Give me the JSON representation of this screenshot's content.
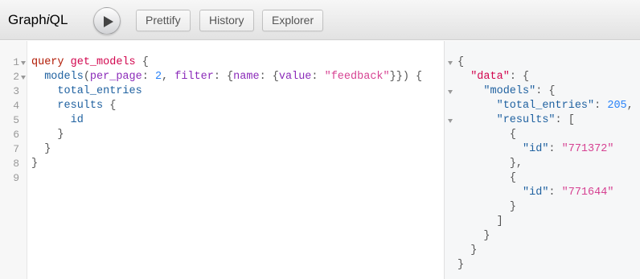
{
  "app": {
    "title_prefix": "Graph",
    "title_italic": "i",
    "title_suffix": "QL"
  },
  "toolbar": {
    "execute_icon": "play-icon",
    "prettify_label": "Prettify",
    "history_label": "History",
    "explorer_label": "Explorer"
  },
  "query_editor": {
    "line_numbers": [
      "1",
      "2",
      "3",
      "4",
      "5",
      "6",
      "7",
      "8",
      "9"
    ],
    "lines": [
      {
        "t1": "query",
        "t2": " ",
        "t3": "get_models",
        "t4": " {"
      },
      {
        "t1": "  ",
        "t2": "models",
        "t3": "(",
        "t4": "per_page",
        "t5": ": ",
        "t6": "2",
        "t7": ", ",
        "t8": "filter",
        "t9": ": {",
        "t10": "name",
        "t11": ": {",
        "t12": "value",
        "t13": ": ",
        "t14": "\"feedback\"",
        "t15": "}}) {"
      },
      {
        "t1": "    ",
        "t2": "total_entries"
      },
      {
        "t1": "    ",
        "t2": "results",
        "t3": " {"
      },
      {
        "t1": "      ",
        "t2": "id"
      },
      {
        "t1": "    ",
        "t2": "}"
      },
      {
        "t1": "  ",
        "t2": "}"
      },
      {
        "t1": "",
        "t2": "}"
      },
      {
        "t1": "",
        "t2": ""
      }
    ]
  },
  "result_viewer": {
    "lines": [
      {
        "t1": "{"
      },
      {
        "t1": "  ",
        "t2": "\"data\"",
        "t3": ": {"
      },
      {
        "t1": "    ",
        "t2": "\"models\"",
        "t3": ": {"
      },
      {
        "t1": "      ",
        "t2": "\"total_entries\"",
        "t3": ": ",
        "t4": "205",
        "t5": ","
      },
      {
        "t1": "      ",
        "t2": "\"results\"",
        "t3": ": ["
      },
      {
        "t1": "        ",
        "t2": "{"
      },
      {
        "t1": "          ",
        "t2": "\"id\"",
        "t3": ": ",
        "t4": "\"771372\""
      },
      {
        "t1": "        ",
        "t2": "},"
      },
      {
        "t1": "        ",
        "t2": "{"
      },
      {
        "t1": "          ",
        "t2": "\"id\"",
        "t3": ": ",
        "t4": "\"771644\""
      },
      {
        "t1": "        ",
        "t2": "}"
      },
      {
        "t1": "      ",
        "t2": "]"
      },
      {
        "t1": "    ",
        "t2": "}"
      },
      {
        "t1": "  ",
        "t2": "}"
      },
      {
        "t1": "}"
      }
    ]
  }
}
